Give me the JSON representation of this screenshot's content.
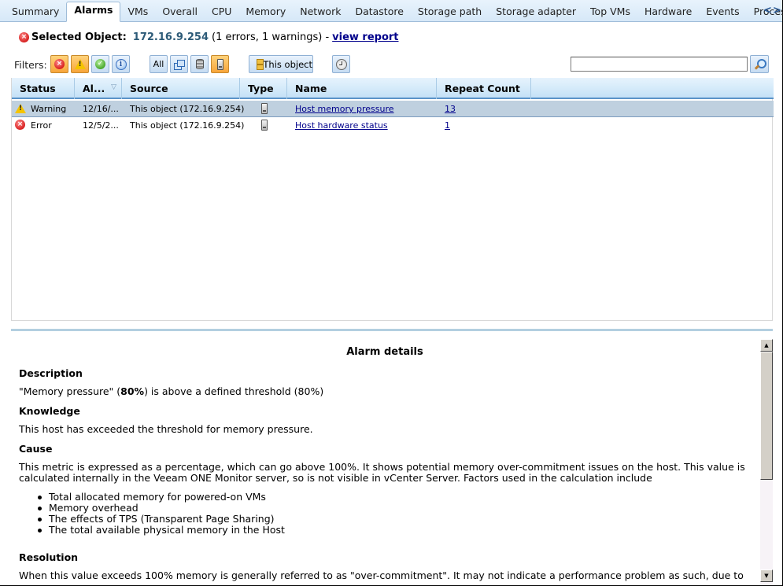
{
  "tabs": [
    {
      "label": "Summary",
      "active": false
    },
    {
      "label": "Alarms",
      "active": true
    },
    {
      "label": "VMs",
      "active": false
    },
    {
      "label": "Overall",
      "active": false
    },
    {
      "label": "CPU",
      "active": false
    },
    {
      "label": "Memory",
      "active": false
    },
    {
      "label": "Network",
      "active": false
    },
    {
      "label": "Datastore",
      "active": false
    },
    {
      "label": "Storage path",
      "active": false
    },
    {
      "label": "Storage adapter",
      "active": false
    },
    {
      "label": "Top VMs",
      "active": false
    },
    {
      "label": "Hardware",
      "active": false
    },
    {
      "label": "Events",
      "active": false
    },
    {
      "label": "Processes",
      "active": false
    }
  ],
  "tab_nav": {
    "prev": "<",
    "next": ">"
  },
  "selected_object": {
    "label": "Selected Object:",
    "ip": "172.16.9.254",
    "counts": "(1 errors, 1 warnings) -",
    "link": "view report",
    "status_icon": "error-icon"
  },
  "filters": {
    "label": "Filters:",
    "severity": [
      {
        "name": "error",
        "icon": "error-icon",
        "active": true
      },
      {
        "name": "warning",
        "icon": "warning-icon",
        "active": true
      },
      {
        "name": "resolved",
        "icon": "ok-icon",
        "active": false
      },
      {
        "name": "info",
        "icon": "info-icon",
        "active": false
      }
    ],
    "object_types": [
      {
        "name": "all",
        "label": "All",
        "active": false
      },
      {
        "name": "vm",
        "icon": "vm-icon",
        "active": false
      },
      {
        "name": "datastore",
        "icon": "datastore-icon",
        "active": false
      },
      {
        "name": "host",
        "icon": "host-icon",
        "active": true
      }
    ],
    "scope_label": "This object",
    "time_icon": "clock-icon"
  },
  "search": {
    "value": "",
    "placeholder": ""
  },
  "grid": {
    "columns": [
      "Status",
      "Al...",
      "Source",
      "Type",
      "Name",
      "Repeat Count"
    ],
    "sort_indicator": "▽",
    "rows": [
      {
        "status": "Warning",
        "status_icon": "warning-icon",
        "time": "12/16/...",
        "source": "This object (172.16.9.254)",
        "type": "host",
        "name": "Host memory pressure",
        "repeat": "13",
        "selected": true
      },
      {
        "status": "Error",
        "status_icon": "error-icon",
        "time": "12/5/2...",
        "source": "This object (172.16.9.254)",
        "type": "host",
        "name": "Host hardware status",
        "repeat": "1",
        "selected": false
      }
    ]
  },
  "details": {
    "title": "Alarm details",
    "description_heading": "Description",
    "description_pre": "\"Memory pressure\" (",
    "description_bold": "80%",
    "description_post": ") is above a defined threshold (80%)",
    "knowledge_heading": "Knowledge",
    "knowledge_text": "This host has exceeded the threshold for memory pressure.",
    "cause_heading": "Cause",
    "cause_text": "This metric is expressed as a percentage, which can go above 100%. It shows potential memory over-commitment issues on the host. This value is calculated internally in the Veeam ONE Monitor server, so is not visible in vCenter Server. Factors used in the calculation include",
    "cause_list": [
      "Total allocated memory for powered-on VMs",
      "Memory overhead",
      "The effects of TPS (Transparent Page Sharing)",
      "The total available physical memory in the Host"
    ],
    "resolution_heading": "Resolution",
    "resolution_text": "When this value exceeds 100% memory is generally referred to as \"over-commitment\". It may not indicate a performance problem as such, due to"
  }
}
